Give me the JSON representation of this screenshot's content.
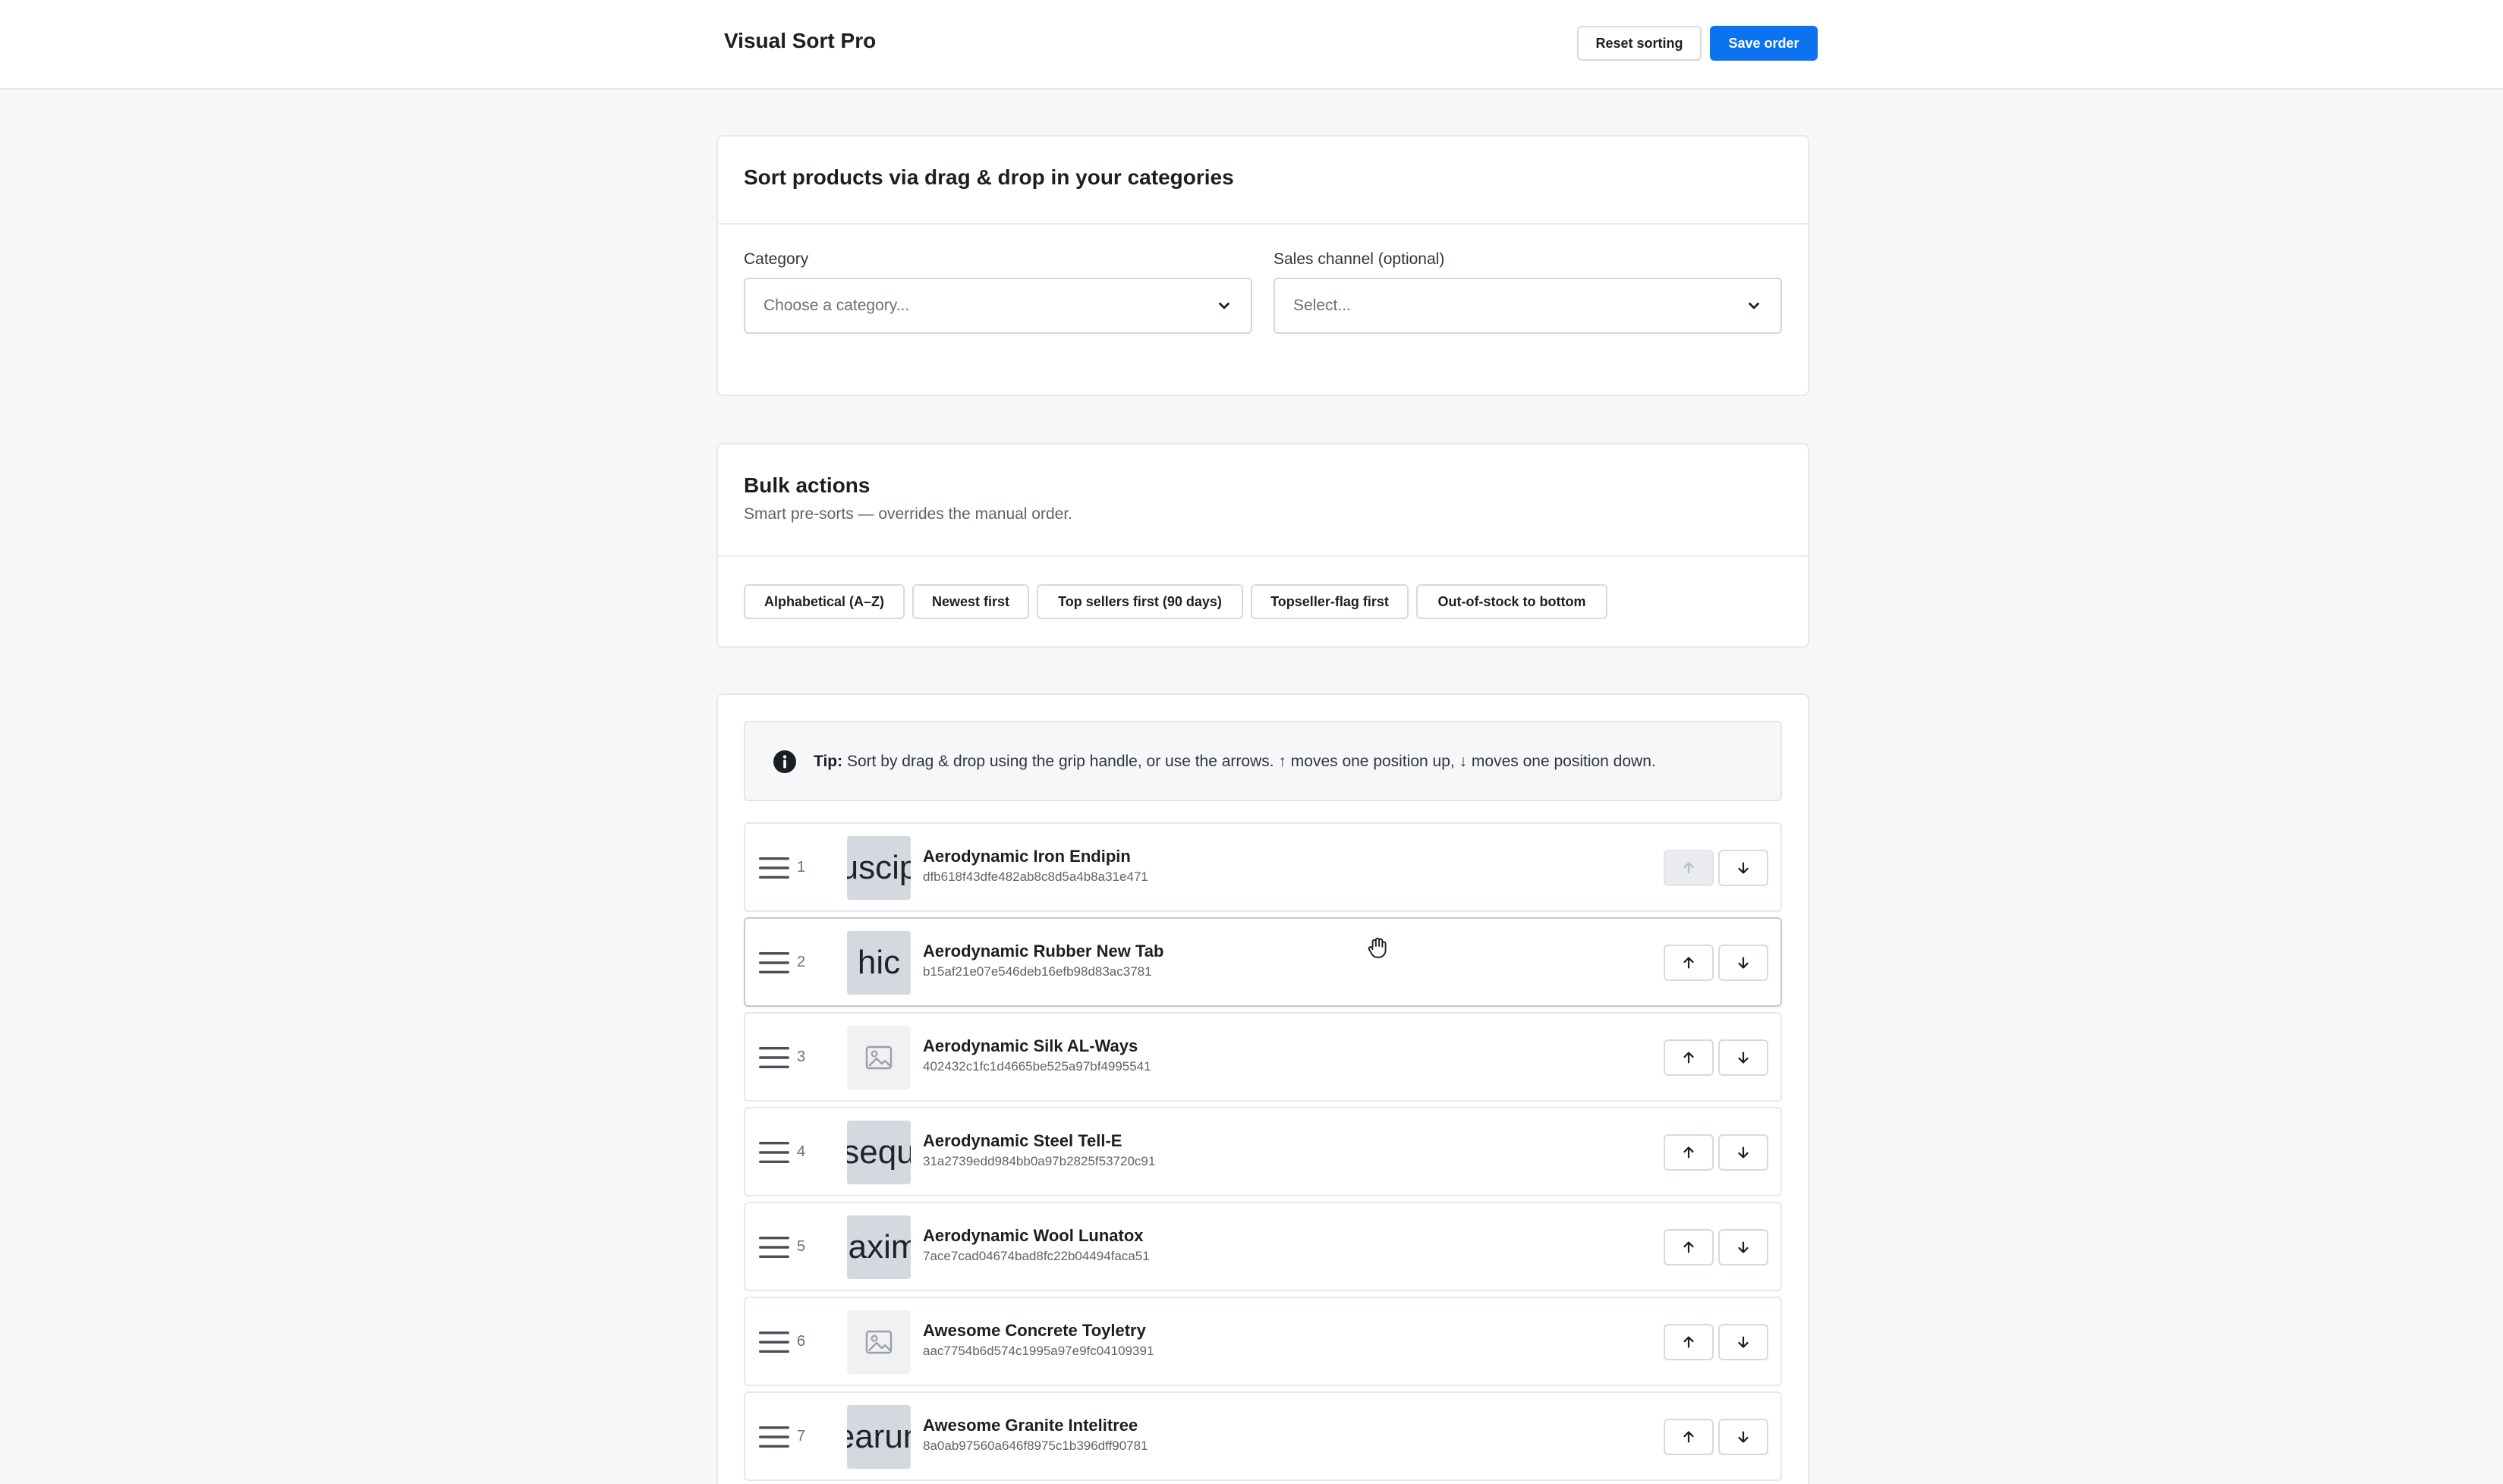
{
  "app": {
    "title": "Visual Sort Pro"
  },
  "toolbar": {
    "reset_label": "Reset sorting",
    "save_label": "Save order"
  },
  "sort_card": {
    "title": "Sort products via drag & drop in your categories",
    "category": {
      "label": "Category",
      "placeholder": "Choose a category..."
    },
    "sales_channel": {
      "label": "Sales channel (optional)",
      "placeholder": "Select..."
    }
  },
  "bulk": {
    "title": "Bulk actions",
    "subtitle": "Smart pre-sorts — overrides the manual order.",
    "actions": [
      "Alphabetical (A–Z)",
      "Newest first",
      "Top sellers first (90 days)",
      "Topseller-flag first",
      "Out-of-stock to bottom"
    ]
  },
  "tip": {
    "strong": "Tip:",
    "text": " Sort by drag & drop using the grip handle, or use the arrows. ↑ moves one position up, ↓ moves one position down."
  },
  "products": [
    {
      "pos": "1",
      "name": "Aerodynamic Iron Endipin",
      "id": "dfb618f43dfe482ab8c8d5a4b8a31e471",
      "thumb_text": "suscipit",
      "up_disabled": true
    },
    {
      "pos": "2",
      "name": "Aerodynamic Rubber New Tab",
      "id": "b15af21e07e546deb16efb98d83ac3781",
      "thumb_text": "hic",
      "up_disabled": false
    },
    {
      "pos": "3",
      "name": "Aerodynamic Silk AL-Ways",
      "id": "402432c1fc1d4665be525a97bf4995541",
      "thumb_text": "",
      "up_disabled": false
    },
    {
      "pos": "4",
      "name": "Aerodynamic Steel Tell-E",
      "id": "31a2739edd984bb0a97b2825f53720c91",
      "thumb_text": "sequ",
      "up_disabled": false
    },
    {
      "pos": "5",
      "name": "Aerodynamic Wool Lunatox",
      "id": "7ace7cad04674bad8fc22b04494faca51",
      "thumb_text": "maxime",
      "up_disabled": false
    },
    {
      "pos": "6",
      "name": "Awesome Concrete Toyletry",
      "id": "aac7754b6d574c1995a97e9fc04109391",
      "thumb_text": "",
      "up_disabled": false
    },
    {
      "pos": "7",
      "name": "Awesome Granite Intelitree",
      "id": "8a0ab97560a646f8975c1b396dff90781",
      "thumb_text": "earun",
      "up_disabled": false
    }
  ],
  "colors": {
    "accent": "#0b72f0",
    "border": "#e5e8ec",
    "background": "#f6f7f9"
  }
}
